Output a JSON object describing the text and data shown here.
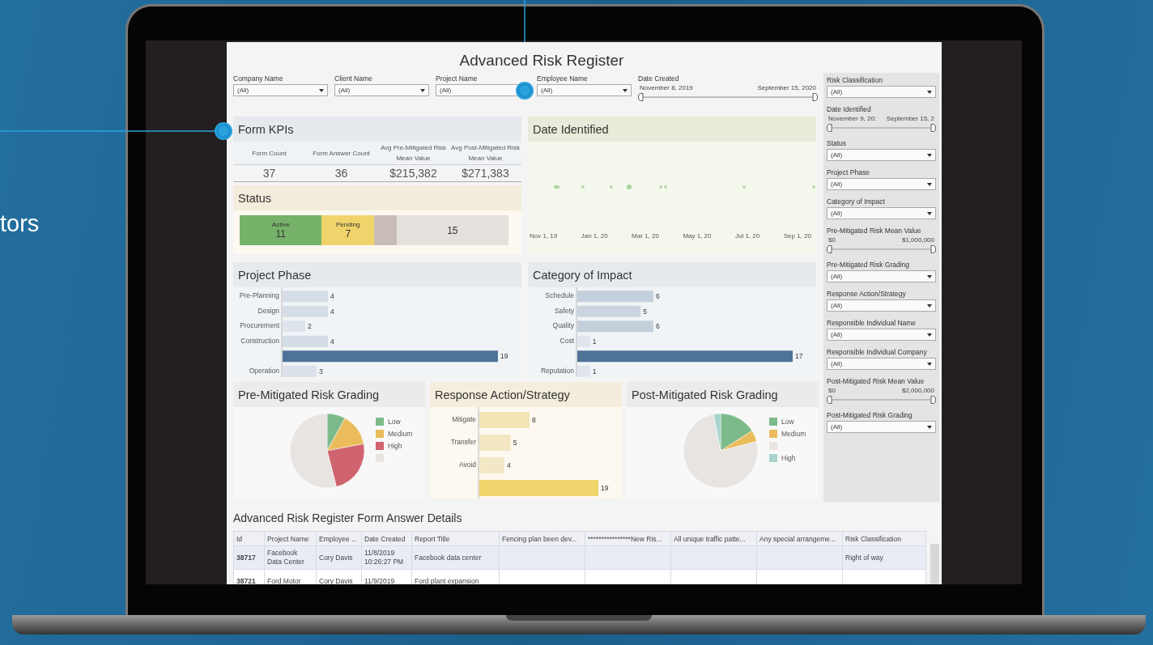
{
  "side_text": "tors",
  "dashboard": {
    "title": "Advanced Risk Register",
    "filters": [
      {
        "kind": "dropdown",
        "label": "Company Name",
        "value": "(All)"
      },
      {
        "kind": "dropdown",
        "label": "Client Name",
        "value": "(All)"
      },
      {
        "kind": "dropdown",
        "label": "Project Name",
        "value": "(All)"
      },
      {
        "kind": "dropdown",
        "label": "Employee Name",
        "value": "(All)"
      },
      {
        "kind": "range",
        "label": "Date Created",
        "min": "November 8, 2019",
        "max": "September 15, 2020",
        "level": 1
      }
    ],
    "kpis": {
      "title": "Form KPIs",
      "columns": [
        {
          "header": "Form Count",
          "value": "37"
        },
        {
          "header": "Form Answer Count",
          "value": "36"
        },
        {
          "header": "Avg Pre-Mitigated Risk Mean Value",
          "value": "$215,382"
        },
        {
          "header": "Avg Post-Mitigated Risk Mean Value",
          "value": "$271,383"
        }
      ]
    },
    "status": {
      "title": "Status",
      "segments": [
        {
          "label": "Active",
          "value": "11",
          "color": "#76b26a"
        },
        {
          "label": "Pending",
          "value": "7",
          "color": "#f0d36a"
        },
        {
          "color": "#c8bcb8"
        },
        {
          "value": "15",
          "color": "#e6e0dd"
        }
      ]
    },
    "date_identified": {
      "title": "Date Identified",
      "axis_labels": [
        "Nov 1, 19",
        "Jan 1, 20",
        "Mar 1, 20",
        "May 1, 20",
        "Jul 1, 20",
        "Sep 1, 20"
      ]
    },
    "project_phase": {
      "title": "Project Phase",
      "chart_data": {
        "type": "bar",
        "orientation": "horizontal",
        "data_labels": true,
        "categories": [
          "Pre-Planning",
          "Design",
          "Procurement",
          "Construction",
          null,
          "Operation"
        ],
        "series": [
          {
            "values": [
              4,
              4,
              2,
              4,
              19,
              3
            ]
          }
        ]
      }
    },
    "category_of_impact": {
      "title": "Category of Impact",
      "chart_data": {
        "type": "bar",
        "orientation": "horizontal",
        "data_labels": true,
        "categories": [
          "Schedule",
          "Safety",
          "Quality",
          "Cost",
          null,
          "Reputation"
        ],
        "series": [
          {
            "values": [
              6,
              5,
              6,
              1,
              17,
              1
            ]
          }
        ]
      }
    },
    "pre_grading": {
      "title": "Pre-Mitigated Risk Grading",
      "legend": [
        {
          "label": "Low",
          "color": "#7dba8a"
        },
        {
          "label": "Medium",
          "color": "#ebbc5c"
        },
        {
          "label": "High",
          "color": "#d0646e"
        },
        {
          "color": "#e8e4e2"
        }
      ]
    },
    "response": {
      "title": "Response Action/Strategy",
      "chart_data": {
        "type": "bar",
        "orientation": "horizontal",
        "data_labels": true,
        "categories": [
          "Mitigate",
          "Transfer",
          "Avoid",
          null
        ],
        "series": [
          {
            "values": [
              8,
              5,
              4,
              19
            ]
          }
        ]
      }
    },
    "post_grading": {
      "title": "Post-Mitigated Risk Grading",
      "legend": [
        {
          "label": "Low",
          "color": "#7dba8a"
        },
        {
          "label": "Medium",
          "color": "#ebbc5c"
        },
        {
          "color": "#e8e4e2"
        },
        {
          "label": "High",
          "color": "#a8d4cf"
        }
      ]
    },
    "sidebar": [
      {
        "kind": "dropdown",
        "label": "Risk Classification",
        "value": "(All)"
      },
      {
        "kind": "range",
        "label": "Date Identified",
        "min": "November 9, 20:",
        "max": "September 15, 2",
        "level": 1
      },
      {
        "kind": "dropdown",
        "label": "Status",
        "value": "(All)"
      },
      {
        "kind": "dropdown",
        "label": "Project Phase",
        "value": "(All)"
      },
      {
        "kind": "dropdown",
        "label": "Category of Impact",
        "value": "(All)"
      },
      {
        "kind": "range",
        "label": "Pre-Mitigated Risk Mean Value",
        "min": "$0",
        "max": "$1,000,000",
        "level": 1
      },
      {
        "kind": "dropdown",
        "label": "Pre-Mitigated Risk Grading",
        "value": "(All)"
      },
      {
        "kind": "dropdown",
        "label": "Response Action/Strategy",
        "value": "(All)"
      },
      {
        "kind": "dropdown",
        "label": "Responsible Individual Name",
        "value": "(All)"
      },
      {
        "kind": "dropdown",
        "label": "Responsible Individual Company",
        "value": "(All)"
      },
      {
        "kind": "range",
        "label": "Post-Mitigated Risk Mean Value",
        "min": "$0",
        "max": "$2,000,000",
        "level": 1
      },
      {
        "kind": "dropdown",
        "label": "Post-Mitigated Risk Grading",
        "value": "(All)"
      }
    ],
    "table": {
      "title": "Advanced Risk Register Form Answer Details",
      "columns": [
        "Id",
        "Project Name",
        "Employee ...",
        "Date Created",
        "Report Title",
        "Fencing plan been dev...",
        "****************New Ris...",
        "All unique traffic patte...",
        "Any special arrangeme...",
        "Risk Classification"
      ],
      "rows": [
        [
          "38717",
          "Facebook Data Center",
          "Cory Davis",
          "11/8/2019 10:26:27 PM",
          "Facebook data center",
          "",
          "",
          "",
          "",
          "Right of way"
        ],
        [
          "38721",
          "Ford Motor",
          "Cory Davis",
          "11/9/2019",
          "Ford plant expansion",
          "",
          "",
          "",
          "",
          ""
        ]
      ]
    }
  }
}
